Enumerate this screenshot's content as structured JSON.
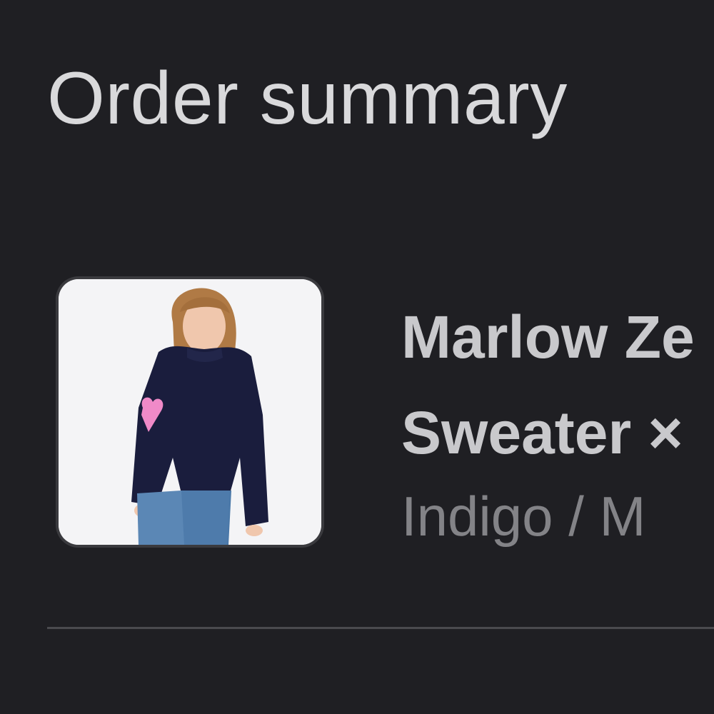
{
  "order_summary": {
    "title": "Order summary",
    "items": [
      {
        "name_line1": "Marlow Ze",
        "name_line2": "Sweater ×",
        "variant": "Indigo / M",
        "image_icon": "product-photo-sweater"
      }
    ]
  },
  "colors": {
    "background": "#1f1f23",
    "title_text": "#d9d9db",
    "name_text": "#c9c9cc",
    "variant_text": "#838387",
    "divider": "#4a4a4e"
  }
}
